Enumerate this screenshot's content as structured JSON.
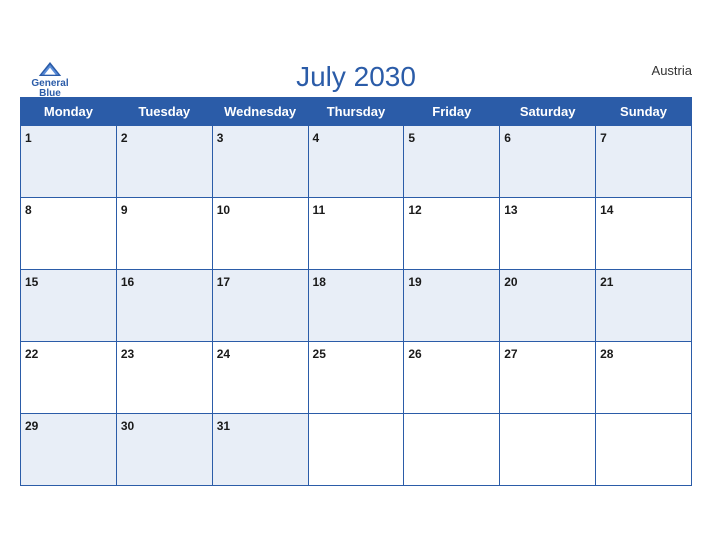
{
  "calendar": {
    "title": "July 2030",
    "country": "Austria",
    "logo": {
      "line1": "General",
      "line2": "Blue"
    },
    "weekdays": [
      "Monday",
      "Tuesday",
      "Wednesday",
      "Thursday",
      "Friday",
      "Saturday",
      "Sunday"
    ],
    "weeks": [
      [
        {
          "day": 1
        },
        {
          "day": 2
        },
        {
          "day": 3
        },
        {
          "day": 4
        },
        {
          "day": 5
        },
        {
          "day": 6
        },
        {
          "day": 7
        }
      ],
      [
        {
          "day": 8
        },
        {
          "day": 9
        },
        {
          "day": 10
        },
        {
          "day": 11
        },
        {
          "day": 12
        },
        {
          "day": 13
        },
        {
          "day": 14
        }
      ],
      [
        {
          "day": 15
        },
        {
          "day": 16
        },
        {
          "day": 17
        },
        {
          "day": 18
        },
        {
          "day": 19
        },
        {
          "day": 20
        },
        {
          "day": 21
        }
      ],
      [
        {
          "day": 22
        },
        {
          "day": 23
        },
        {
          "day": 24
        },
        {
          "day": 25
        },
        {
          "day": 26
        },
        {
          "day": 27
        },
        {
          "day": 28
        }
      ],
      [
        {
          "day": 29
        },
        {
          "day": 30
        },
        {
          "day": 31
        },
        {
          "day": null
        },
        {
          "day": null
        },
        {
          "day": null
        },
        {
          "day": null
        }
      ]
    ]
  }
}
